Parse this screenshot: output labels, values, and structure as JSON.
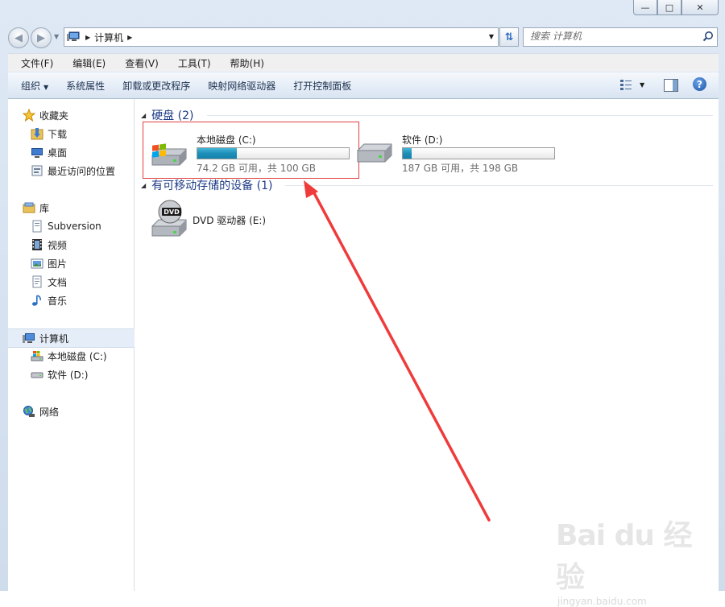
{
  "window": {
    "controls": {
      "minimize": "—",
      "maximize": "□",
      "close": "✕"
    }
  },
  "address": {
    "path": "计算机",
    "search_placeholder": "搜索 计算机"
  },
  "menubar": [
    "文件(F)",
    "编辑(E)",
    "查看(V)",
    "工具(T)",
    "帮助(H)"
  ],
  "commandbar": [
    "组织",
    "系统属性",
    "卸载或更改程序",
    "映射网络驱动器",
    "打开控制面板"
  ],
  "nav": {
    "favorites": {
      "label": "收藏夹",
      "items": [
        "下载",
        "桌面",
        "最近访问的位置"
      ]
    },
    "libraries": {
      "label": "库",
      "items": [
        "Subversion",
        "视频",
        "图片",
        "文档",
        "音乐"
      ]
    },
    "computer": {
      "label": "计算机",
      "items": [
        "本地磁盘 (C:)",
        "软件 (D:)"
      ]
    },
    "network": {
      "label": "网络"
    }
  },
  "content": {
    "hard_disks": {
      "header": "硬盘 (2)",
      "drives": [
        {
          "label": "本地磁盘 (C:)",
          "free": "74.2 GB 可用，共 100 GB",
          "used_fraction": 0.258
        },
        {
          "label": "软件 (D:)",
          "free": "187 GB 可用，共 198 GB",
          "used_fraction": 0.056
        }
      ]
    },
    "removable": {
      "header": "有可移动存储的设备 (1)",
      "drives": [
        {
          "label": "DVD 驱动器 (E:)",
          "icon_text": "DVD"
        }
      ]
    }
  },
  "annotation": {
    "highlight_color": "#e04040",
    "arrow_color": "#ef3b3b"
  },
  "watermark": {
    "logo": "Bai du 经验",
    "sub": "jingyan.baidu.com"
  },
  "colors": {
    "header_text": "#1e3b87",
    "drive_bar_fill": "#1d8fb8"
  }
}
